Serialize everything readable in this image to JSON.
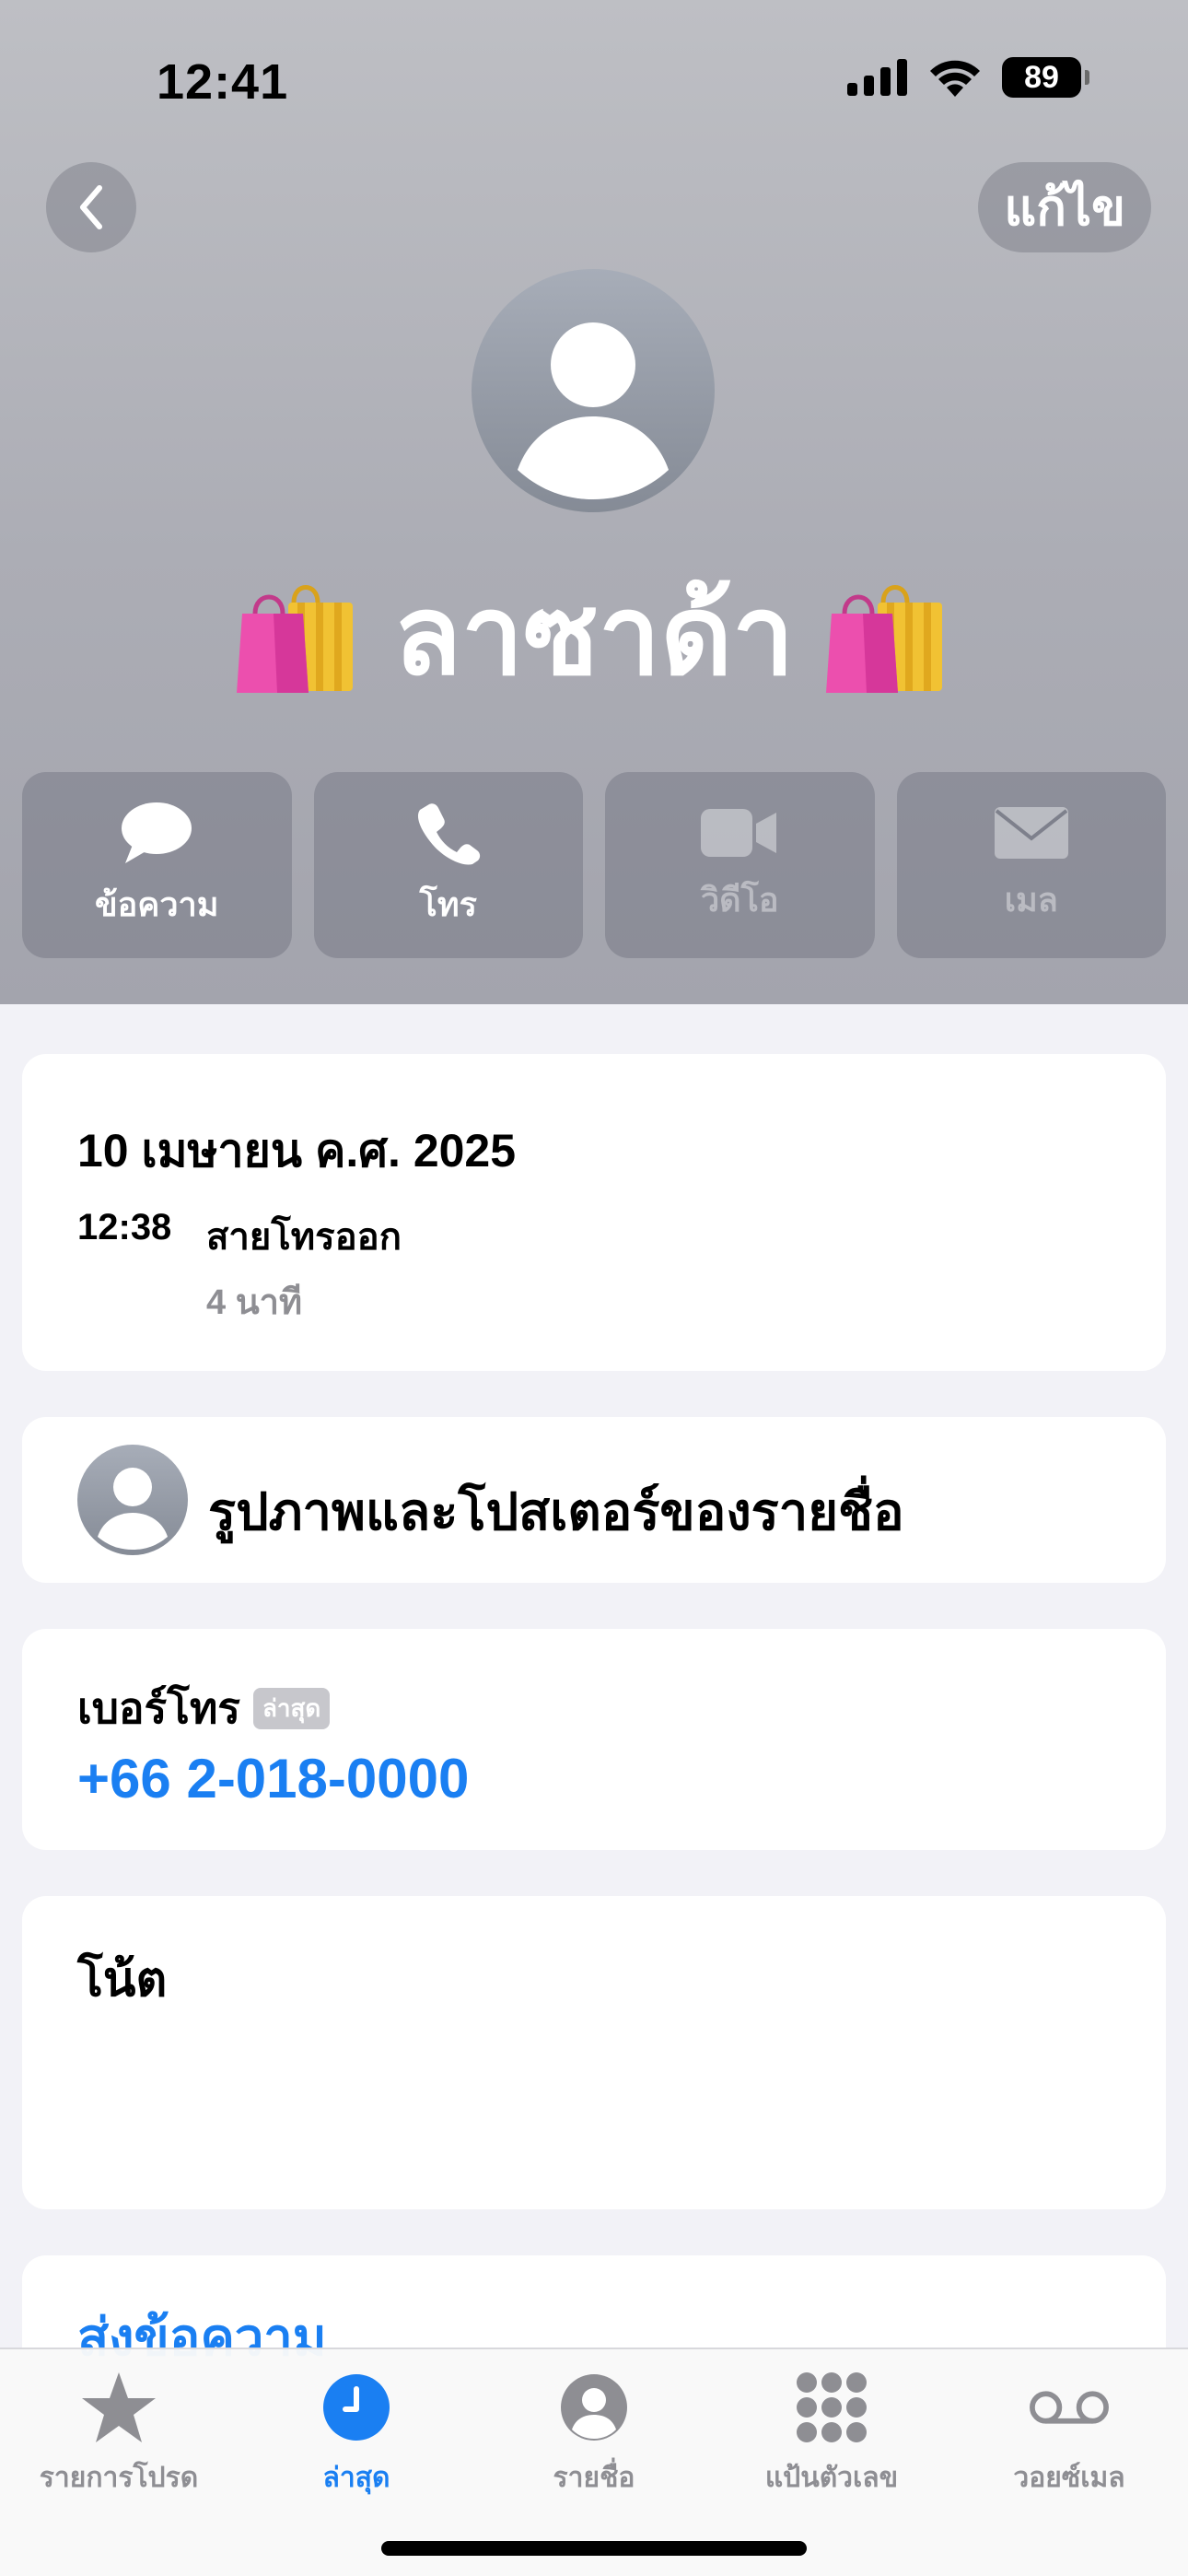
{
  "status_bar": {
    "time": "12:41",
    "battery": "89"
  },
  "header": {
    "edit_label": "แก้ไข",
    "contact_name": "ลาซาด้า",
    "name_emoji": "🛍️"
  },
  "actions": [
    {
      "label": "ข้อความ",
      "icon": "message-icon",
      "enabled": true
    },
    {
      "label": "โทร",
      "icon": "phone-icon",
      "enabled": true
    },
    {
      "label": "วิดีโอ",
      "icon": "video-icon",
      "enabled": false
    },
    {
      "label": "เมล",
      "icon": "mail-icon",
      "enabled": false
    }
  ],
  "call_log": {
    "date": "10 เมษายน ค.ศ. 2025",
    "time": "12:38",
    "type": "สายโทรออก",
    "duration": "4 นาที"
  },
  "photo_poster": {
    "label": "รูปภาพและโปสเตอร์ของรายชื่อ"
  },
  "phone": {
    "label": "เบอร์โทร",
    "badge": "ล่าสุด",
    "number": "+66 2-018-0000"
  },
  "note": {
    "label": "โน้ต"
  },
  "send_message": {
    "label": "ส่งข้อความ"
  },
  "tabbar": {
    "active": "ล่าสุด",
    "items": [
      {
        "label": "รายการโปรด",
        "icon": "star-icon"
      },
      {
        "label": "ล่าสุด",
        "icon": "clock-icon"
      },
      {
        "label": "รายชื่อ",
        "icon": "person-circle-icon"
      },
      {
        "label": "แป้นตัวเลข",
        "icon": "keypad-icon"
      },
      {
        "label": "วอยซ์เมล",
        "icon": "voicemail-icon"
      }
    ]
  },
  "colors": {
    "accent": "#1a7ff2",
    "secondary_text": "#8e8e93",
    "background": "#f2f2f7"
  }
}
